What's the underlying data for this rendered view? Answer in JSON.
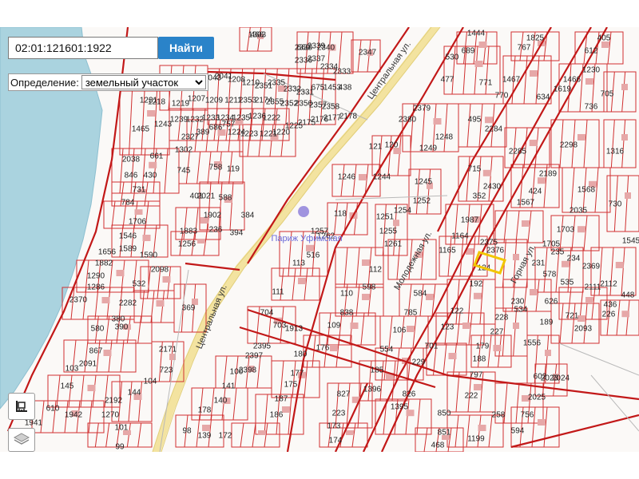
{
  "search": {
    "value": "02:01:121601:1922",
    "button_label": "Найти"
  },
  "definition": {
    "label": "Определение:",
    "selected": "земельный участок"
  },
  "map": {
    "streets": [
      "Центральная ул.",
      "Центральная ул.",
      "Молодежная ул.",
      "Горная ул."
    ],
    "place_name": "Париж Уфимская",
    "parcel_labels": [
      "1303",
      "2338",
      "2339",
      "2340",
      "2347",
      "1444",
      "1825",
      "405",
      "2336",
      "2337",
      "2334",
      "2333",
      "689",
      "767",
      "612",
      "2043",
      "2041",
      "1208",
      "1210",
      "2351",
      "2335",
      "2332",
      "2331",
      "675",
      "1453",
      "438",
      "530",
      "1467",
      "1466",
      "1230",
      "1231",
      "1218",
      "1219",
      "1207",
      "1209",
      "1211",
      "2353",
      "2174",
      "2355",
      "2352",
      "2356",
      "2357",
      "2358",
      "477",
      "771",
      "1619",
      "770",
      "705",
      "1465",
      "1243",
      "1239",
      "1232",
      "1233",
      "1234",
      "1235",
      "1236",
      "1222",
      "1223",
      "1224",
      "1221",
      "1220",
      "1225",
      "2175",
      "2176",
      "2177",
      "2178",
      "2379",
      "2380",
      "495",
      "634",
      "736",
      "2038",
      "661",
      "1302",
      "2327",
      "389",
      "686",
      "757",
      "121",
      "120",
      "1244",
      "1248",
      "1249",
      "2284",
      "2285",
      "2298",
      "1316",
      "846",
      "430",
      "745",
      "758",
      "119",
      "1246",
      "1245",
      "1252",
      "715",
      "2430",
      "352",
      "2189",
      "424",
      "1567",
      "1568",
      "730",
      "731",
      "401",
      "588",
      "2021",
      "784",
      "118",
      "1251",
      "1255",
      "1254",
      "1987",
      "2035",
      "1703",
      "1706",
      "1902",
      "236",
      "394",
      "384",
      "1883",
      "1256",
      "1257",
      "1262",
      "1261",
      "1164",
      "1165",
      "2375",
      "2376",
      "1705",
      "235",
      "234",
      "2369",
      "1545",
      "1546",
      "1589",
      "1590",
      "2098",
      "1882",
      "1656",
      "516",
      "113",
      "112",
      "598",
      "584",
      "124",
      "192",
      "231",
      "578",
      "535",
      "2111",
      "2112",
      "1290",
      "1286",
      "532",
      "111",
      "110",
      "838",
      "785",
      "122",
      "123",
      "230",
      "534",
      "626",
      "436",
      "448",
      "2370",
      "2282",
      "369",
      "109",
      "106",
      "554",
      "701",
      "229",
      "228",
      "227",
      "226",
      "721",
      "2093",
      "380",
      "390",
      "580",
      "704",
      "703",
      "1913",
      "2395",
      "2397",
      "2398",
      "176",
      "180",
      "179",
      "1556",
      "189",
      "188",
      "797",
      "867",
      "2091",
      "2171",
      "723",
      "104",
      "103",
      "145",
      "144",
      "2192",
      "1270",
      "101",
      "100",
      "141",
      "140",
      "178",
      "177",
      "175",
      "187",
      "186",
      "185",
      "1396",
      "826",
      "1395",
      "827",
      "223",
      "222",
      "258",
      "602",
      "2023",
      "2024",
      "2025",
      "756",
      "594",
      "610",
      "1942",
      "1941",
      "99",
      "98",
      "139",
      "172",
      "173",
      "174",
      "850",
      "851",
      "1199",
      "468",
      "466",
      "660"
    ]
  }
}
